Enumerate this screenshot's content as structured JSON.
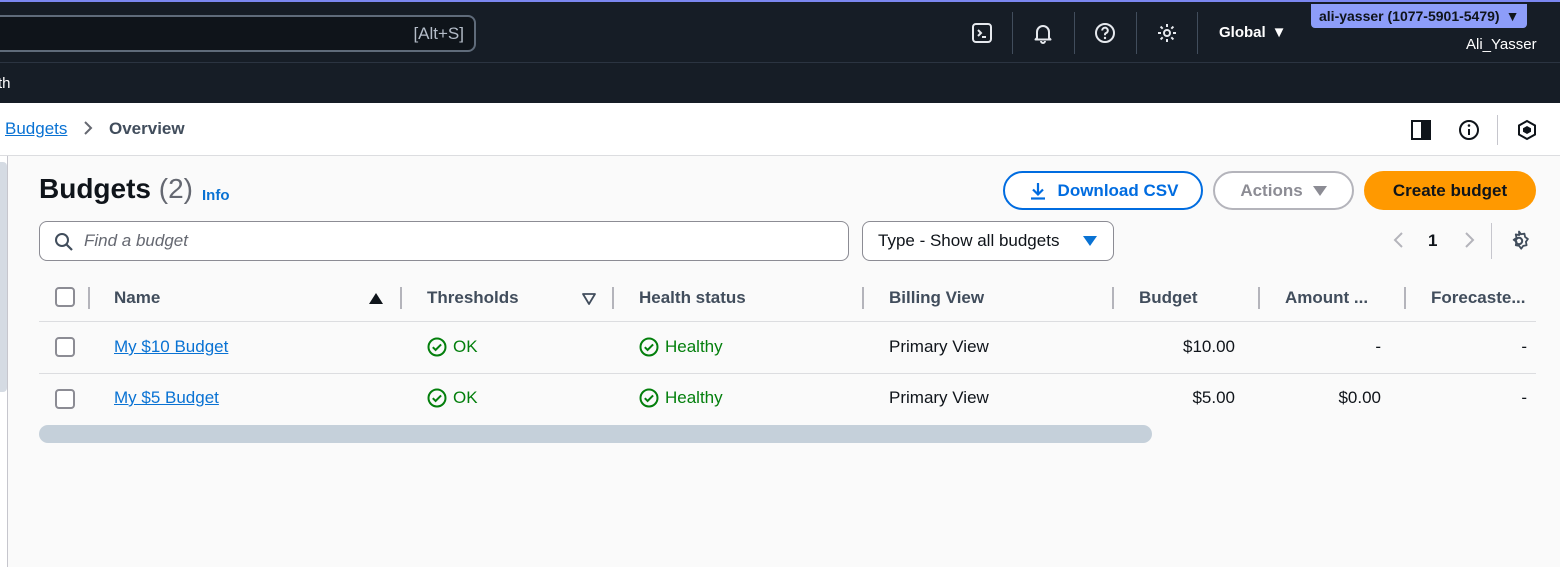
{
  "topnav": {
    "search_shortcut": "[Alt+S]",
    "region": "Global",
    "account": "ali-yasser (1077-5901-5479)",
    "username": "Ali_Yasser"
  },
  "subnav": {
    "text": "th"
  },
  "breadcrumb": {
    "parent": "Budgets",
    "current": "Overview"
  },
  "header": {
    "title": "Budgets",
    "count": "(2)",
    "info": "Info",
    "download_csv": "Download CSV",
    "actions": "Actions",
    "create_budget": "Create budget"
  },
  "filters": {
    "search_placeholder": "Find a budget",
    "type_select": "Type - Show all budgets"
  },
  "pagination": {
    "current_page": "1"
  },
  "table": {
    "columns": [
      "Name",
      "Thresholds",
      "Health status",
      "Billing View",
      "Budget",
      "Amount ...",
      "Forecaste..."
    ],
    "rows": [
      {
        "name": "My $10 Budget",
        "thresholds": "OK",
        "health": "Healthy",
        "billing_view": "Primary View",
        "budget": "$10.00",
        "amount": "-",
        "forecast": "-"
      },
      {
        "name": "My $5 Budget",
        "thresholds": "OK",
        "health": "Healthy",
        "billing_view": "Primary View",
        "budget": "$5.00",
        "amount": "$0.00",
        "forecast": "-"
      }
    ]
  },
  "colors": {
    "nav_bg": "#161d26",
    "link": "#0972d3",
    "primary_button": "#ff9900",
    "success": "#037f0c",
    "account_badge": "#8d9df9"
  }
}
